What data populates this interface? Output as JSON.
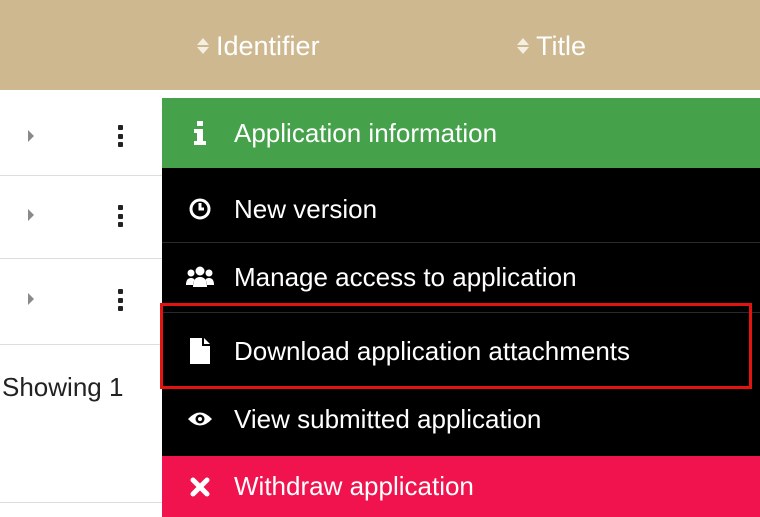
{
  "table": {
    "columns": [
      {
        "label": "Identifier",
        "sortable": true
      },
      {
        "label": "Title",
        "sortable": true
      }
    ],
    "rows": [
      {
        "expand": "collapsed"
      },
      {
        "expand": "collapsed"
      },
      {
        "expand": "collapsed"
      }
    ],
    "pagination_text": "Showing 1"
  },
  "context_menu": {
    "items": [
      {
        "label": "Application information",
        "icon": "info-icon",
        "color": "#45a24b"
      },
      {
        "label": "New version",
        "icon": "clock-icon"
      },
      {
        "label": "Manage access to application",
        "icon": "users-icon"
      },
      {
        "label": "Download application attachments",
        "icon": "file-icon",
        "highlighted": true
      },
      {
        "label": "View submitted application",
        "icon": "eye-icon"
      },
      {
        "label": "Withdraw application",
        "icon": "close-icon",
        "color": "#f0134d"
      }
    ]
  },
  "colors": {
    "header_bg": "#cdb88f",
    "menu_bg": "#000000",
    "highlight_border": "#e3140f"
  }
}
